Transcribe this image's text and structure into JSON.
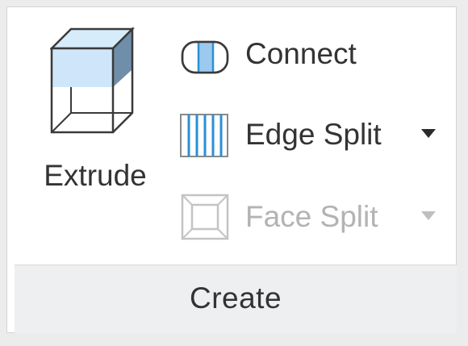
{
  "ribbon": {
    "group_label": "Create",
    "extrude": {
      "label": "Extrude",
      "icon": "extrude-cube-icon"
    },
    "commands": [
      {
        "label": "Connect",
        "icon": "connect-icon",
        "enabled": true,
        "has_dropdown": false
      },
      {
        "label": "Edge Split",
        "icon": "edge-split-icon",
        "enabled": true,
        "has_dropdown": true
      },
      {
        "label": "Face Split",
        "icon": "face-split-icon",
        "enabled": false,
        "has_dropdown": true
      }
    ]
  },
  "colors": {
    "accent_blue": "#2b8fd6",
    "light_blue_fill": "#cfe6fa",
    "text": "#333333",
    "disabled_text": "#b3b3b3",
    "footer_bg": "#eeeff1"
  }
}
